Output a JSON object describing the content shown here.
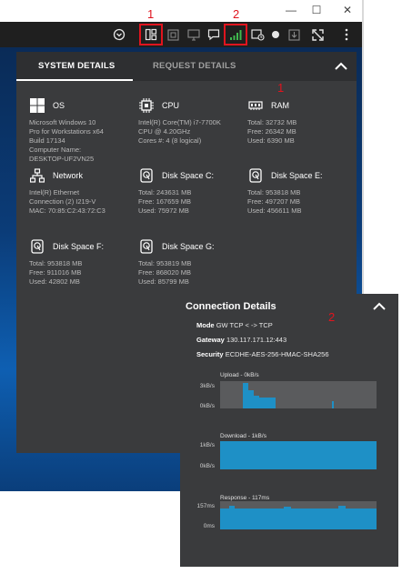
{
  "callouts": {
    "one": "1",
    "two": "2"
  },
  "window": {
    "minimize": "—",
    "maximize": "☐",
    "close": "✕"
  },
  "toolbar": {
    "icons": [
      "chevron-circle-icon",
      "layout-icon",
      "fullscreen-icon",
      "monitor-icon",
      "chat-icon",
      "signal-icon",
      "camera-icon",
      "record-icon",
      "download-icon",
      "expand-icon",
      "more-icon"
    ],
    "highlight_color": "#e0141e",
    "signal_color": "#3fb94e"
  },
  "system_panel": {
    "tabs": {
      "active": "SYSTEM DETAILS",
      "inactive": "REQUEST DETAILS"
    },
    "tiles": [
      {
        "id": "os",
        "title": "OS",
        "icon": "windows-icon",
        "lines": [
          "Microsoft Windows 10",
          "Pro for Workstations x64",
          "Build 17134",
          "Computer Name:",
          "DESKTOP-UF2VN25"
        ]
      },
      {
        "id": "cpu",
        "title": "CPU",
        "icon": "cpu-icon",
        "lines": [
          "Intel(R) Core(TM) i7-7700K",
          "CPU @ 4.20GHz",
          "Cores #: 4 (8 logical)"
        ]
      },
      {
        "id": "ram",
        "title": "RAM",
        "icon": "ram-icon",
        "lines": [
          "Total: 32732 MB",
          "Free: 26342 MB",
          "Used: 6390 MB"
        ]
      },
      {
        "id": "network",
        "title": "Network",
        "icon": "network-icon",
        "lines": [
          "Intel(R) Ethernet",
          "Connection (2) I219-V",
          "MAC: 70:85:C2:43:72:C3"
        ]
      },
      {
        "id": "disk_c",
        "title": "Disk Space C:",
        "icon": "disk-icon",
        "lines": [
          "Total: 243631 MB",
          "Free: 167659 MB",
          "Used: 75972 MB"
        ]
      },
      {
        "id": "disk_e",
        "title": "Disk Space E:",
        "icon": "disk-icon",
        "lines": [
          "Total: 953818 MB",
          "Free: 497207 MB",
          "Used: 456611 MB"
        ]
      },
      {
        "id": "disk_f",
        "title": "Disk Space F:",
        "icon": "disk-icon",
        "lines": [
          "Total: 953818 MB",
          "Free: 911016 MB",
          "Used: 42802 MB"
        ]
      },
      {
        "id": "disk_g",
        "title": "Disk Space G:",
        "icon": "disk-icon",
        "lines": [
          "Total: 953819 MB",
          "Free: 868020 MB",
          "Used: 85799 MB"
        ]
      }
    ]
  },
  "connection": {
    "title": "Connection Details",
    "mode_label": "Mode",
    "mode_value": "GW TCP < -> TCP",
    "gateway_label": "Gateway",
    "gateway_value": "130.117.171.12:443",
    "security_label": "Security",
    "security_value": "ECDHE-AES-256-HMAC-SHA256",
    "graphs": [
      {
        "id": "upload",
        "title": "Upload - 0kB/s",
        "ymax": "3kB/s",
        "ymin": "0kB/s"
      },
      {
        "id": "download",
        "title": "Download - 1kB/s",
        "ymax": "1kB/s",
        "ymin": "0kB/s"
      },
      {
        "id": "response",
        "title": "Response - 117ms",
        "ymax": "157ms",
        "ymin": "0ms"
      }
    ],
    "graph_color": "#1e90c6"
  }
}
